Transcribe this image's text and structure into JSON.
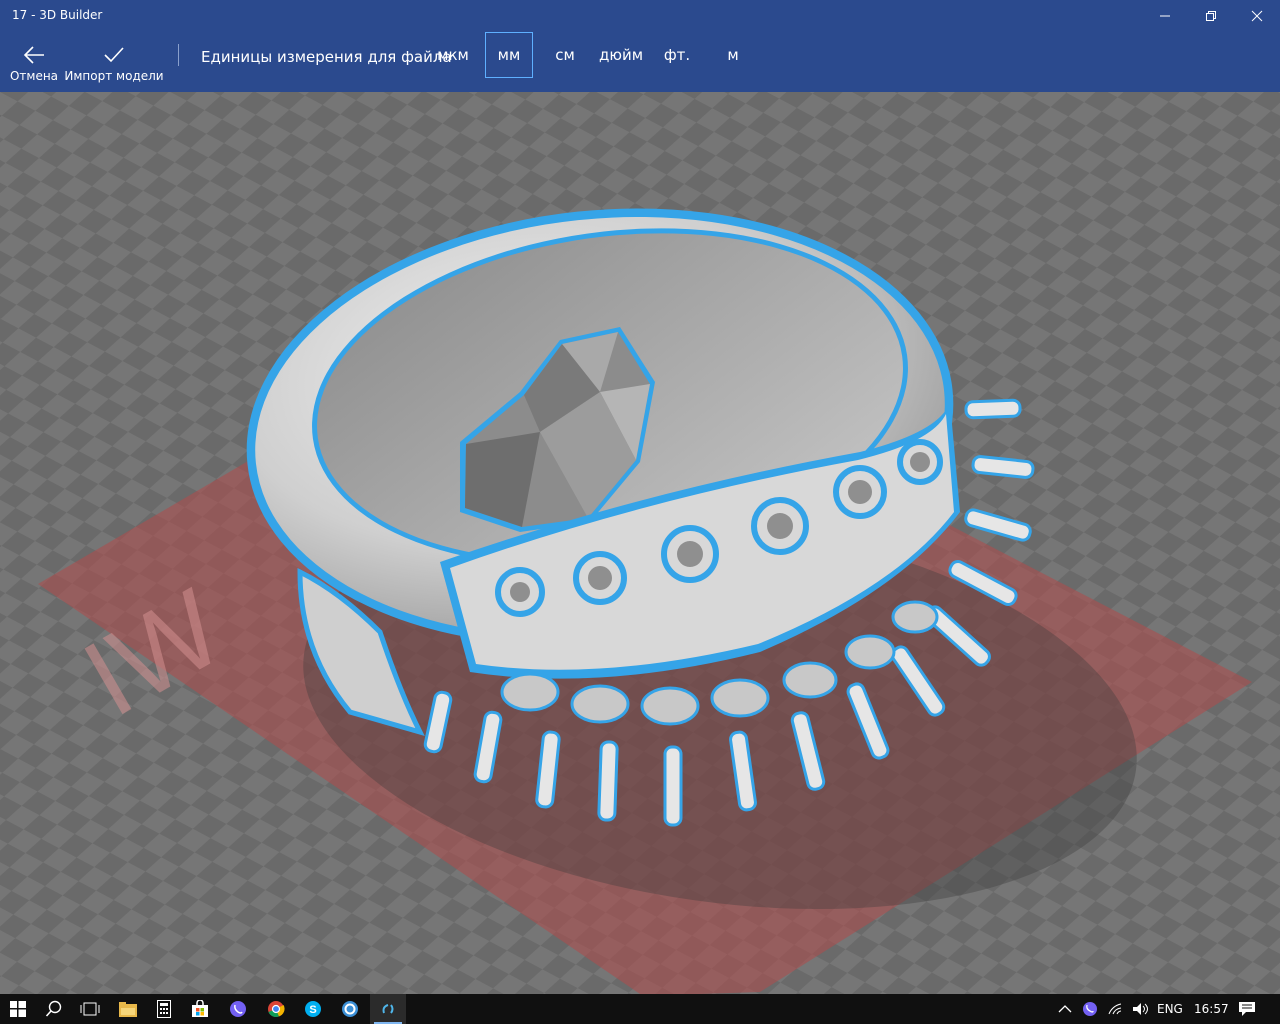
{
  "window": {
    "title": "17 - 3D Builder"
  },
  "toolbar": {
    "cancel_label": "Отмена",
    "import_label": "Импорт модели",
    "units_label": "Единицы измерения для файла",
    "units": [
      "мкм",
      "мм",
      "см",
      "дюйм",
      "фт.",
      "м"
    ],
    "selected_unit": "мм"
  },
  "viewport": {
    "watermark": "WI"
  },
  "taskbar": {
    "apps": [
      "file-explorer",
      "calculator",
      "store",
      "viber",
      "chrome",
      "skype",
      "app",
      "3d-builder"
    ],
    "tray": {
      "language": "ENG",
      "time": "16:57"
    }
  },
  "colors": {
    "accent": "#2b4a8e",
    "selection_outline": "#35a4e8",
    "build_plate": "#b04a4a",
    "taskbar": "#101010"
  }
}
